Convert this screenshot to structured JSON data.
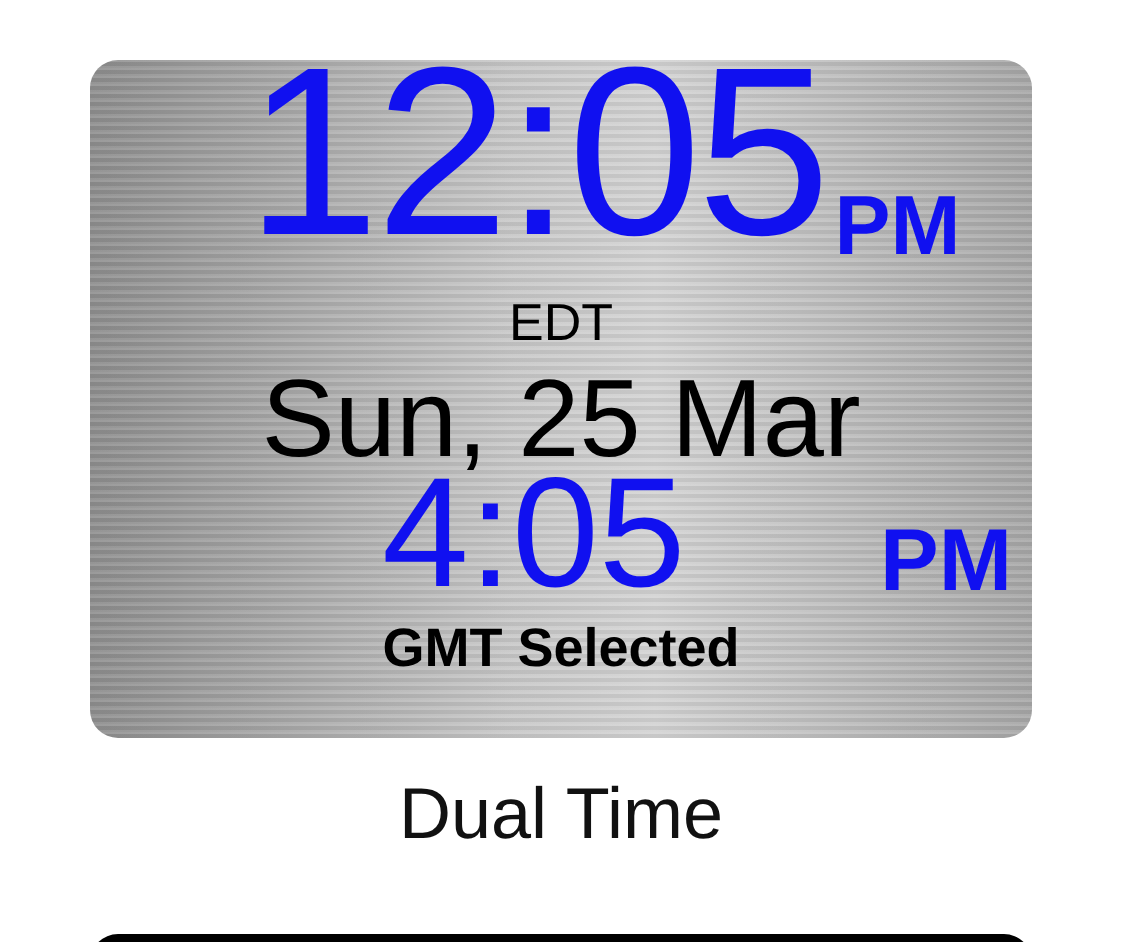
{
  "faces": [
    {
      "kind": "dual",
      "time": "12:05",
      "time_suffix": "PM",
      "zone": "EDT",
      "date": "Sun, 25 Mar",
      "second_time": "4:05",
      "second_suffix": "PM",
      "second_zone": "GMT Selected",
      "title": "Dual Time"
    },
    {
      "kind": "dark"
    }
  ]
}
